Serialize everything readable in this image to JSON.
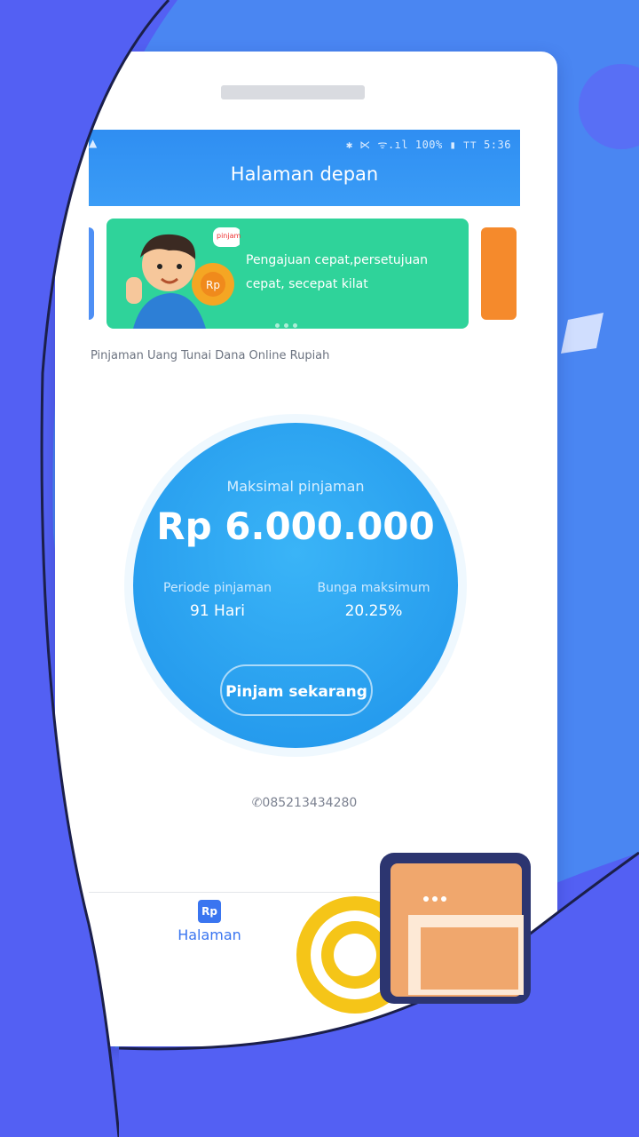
{
  "app": {
    "title": "Halaman depan",
    "status_bar": {
      "left_icon": "alert-icon",
      "right_text": "✱ ⋉ ᯤ.ıl 100% ▮ ⊤⊤ 5:36"
    }
  },
  "banner": {
    "text_line1": "Pengajuan cepat,persetujuan",
    "text_line2": "cepat, secepat kilat",
    "bubble": "pinjam"
  },
  "notice": {
    "text": "Pinjaman Uang Tunai Dana Online Rupiah"
  },
  "loan_card": {
    "subtitle": "Maksimal pinjaman",
    "amount": "Rp 6.000.000",
    "period_label": "Periode pinjaman",
    "period_value": "91 Hari",
    "interest_label": "Bunga maksimum",
    "interest_value": "20.25%",
    "button_label": "Pinjam sekarang"
  },
  "contact": {
    "phone": "085213434280"
  },
  "tabbar": {
    "home_label": "Halaman",
    "home_icon_text": "Rp"
  },
  "colors": {
    "background": "#5360f3",
    "header": "#3a9cf6",
    "banner": "#2fd39a",
    "circle": "#1f93ea",
    "tab_active": "#3a75f0"
  }
}
